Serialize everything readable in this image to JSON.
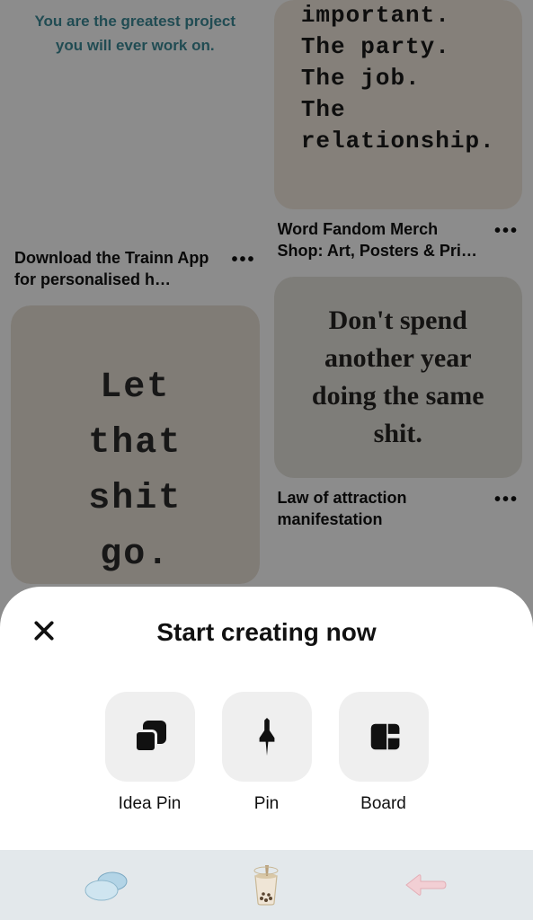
{
  "feed": {
    "left": [
      {
        "quote": "You are the greatest project you will ever work on.",
        "title": "Download the Trainn App for personalised h…"
      },
      {
        "quote": "Let that shit go.",
        "title": ""
      }
    ],
    "right": [
      {
        "quote": "important.\nThe party.\nThe job.\nThe\nrelationship.",
        "title": "Word Fandom Merch Shop: Art, Posters & Pri…"
      },
      {
        "quote": "Don't spend another year doing the same shit.",
        "title": "Law of attraction manifestation"
      }
    ]
  },
  "sheet": {
    "title": "Start creating now",
    "options": {
      "ideaPin": "Idea Pin",
      "pin": "Pin",
      "board": "Board"
    }
  }
}
